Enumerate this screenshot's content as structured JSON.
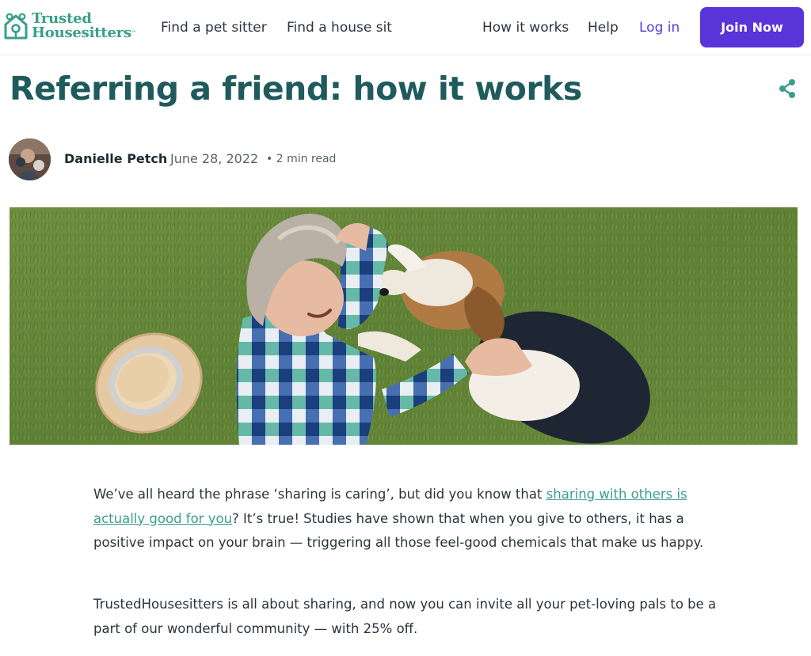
{
  "brand": {
    "line1": "Trusted",
    "line2": "Housesitters",
    "trademark": "™",
    "color": "#3a9e8c"
  },
  "nav": {
    "find_pet_sitter": "Find a pet sitter",
    "find_house_sit": "Find a house sit",
    "how_it_works": "How it works",
    "help": "Help",
    "log_in": "Log in",
    "join_now": "Join Now"
  },
  "colors": {
    "title": "#1f5a5d",
    "accent_purple": "#5a33d9",
    "link_teal": "#3a9e8c"
  },
  "article": {
    "title": "Referring a friend: how it works",
    "share_icon": "share-icon",
    "author": "Danielle Petch",
    "date": "June 28, 2022",
    "read_time": "• 2 min read",
    "hero_image": "woman-and-beagle-lying-on-grass",
    "para1_before": "We’ve all heard the phrase ‘sharing is caring’, but did you know that ",
    "para1_link": "sharing with others is actually good for you",
    "para1_after": "? It’s true! Studies have shown that when you give to others, it has a positive impact on your brain — triggering all those feel-good chemicals that make us happy.",
    "para2": "TrustedHousesitters is all about sharing, and now you can invite all your pet-loving pals to be a part of our wonderful community — with 25% off."
  }
}
